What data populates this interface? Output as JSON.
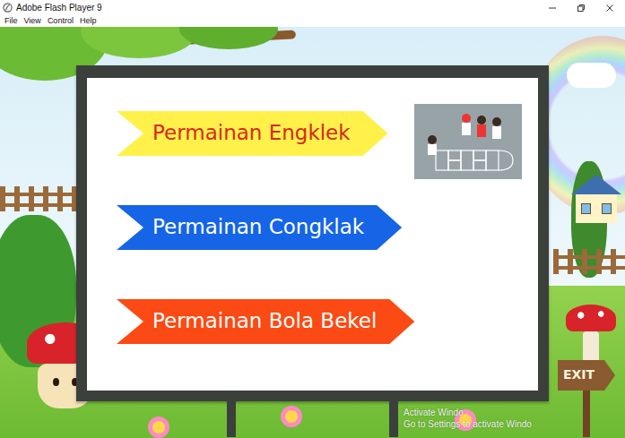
{
  "window": {
    "title": "Adobe Flash Player 9"
  },
  "menu": [
    "File",
    "View",
    "Control",
    "Help"
  ],
  "games": [
    {
      "label": "Permainan Engklek",
      "color": "#fff14a"
    },
    {
      "label": "Permainan Congklak",
      "color": "#1565e6"
    },
    {
      "label": "Permainan Bola Bekel",
      "color": "#fb4a14"
    }
  ],
  "exit": {
    "label": "EXIT"
  },
  "watermark": [
    "Activate Windo",
    "Go to Settings to activate Windo"
  ]
}
